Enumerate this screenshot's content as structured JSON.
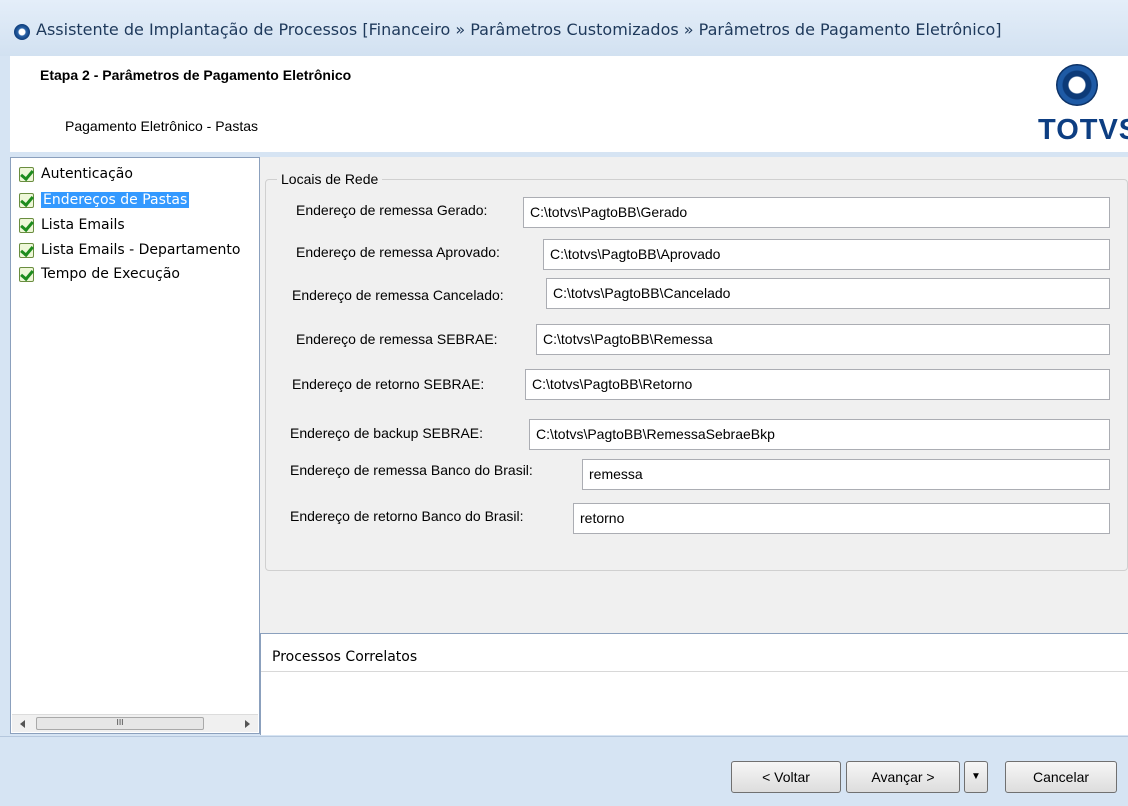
{
  "window": {
    "title": "Assistente de Implantação de Processos [Financeiro » Parâmetros Customizados  » Parâmetros de Pagamento Eletrônico]",
    "app_icon": "app-globe-icon"
  },
  "header": {
    "step_title": "Etapa 2 - Parâmetros de Pagamento Eletrônico",
    "subtitle": "Pagamento Eletrônico - Pastas",
    "logo_text": "TOTVS"
  },
  "tree": {
    "items": [
      {
        "label": "Autenticação",
        "selected": false,
        "icon": "check-icon"
      },
      {
        "label": "Endereços de Pastas",
        "selected": true,
        "icon": "check-icon"
      },
      {
        "label": "Lista Emails",
        "selected": false,
        "icon": "check-icon"
      },
      {
        "label": "Lista Emails - Departamento",
        "selected": false,
        "icon": "check-icon"
      },
      {
        "label": "Tempo de Execução",
        "selected": false,
        "icon": "check-icon"
      }
    ],
    "scroll_thumb_grip": "III"
  },
  "group": {
    "title": "Locais de Rede",
    "fields": [
      {
        "label": "Endereço de remessa Gerado:",
        "value": "C:\\totvs\\PagtoBB\\Gerado"
      },
      {
        "label": "Endereço de remessa Aprovado:",
        "value": "C:\\totvs\\PagtoBB\\Aprovado"
      },
      {
        "label": "Endereço de remessa Cancelado:",
        "value": "C:\\totvs\\PagtoBB\\Cancelado"
      },
      {
        "label": "Endereço de remessa SEBRAE:",
        "value": "C:\\totvs\\PagtoBB\\Remessa"
      },
      {
        "label": "Endereço de retorno SEBRAE:",
        "value": "C:\\totvs\\PagtoBB\\Retorno"
      },
      {
        "label": "Endereço de backup SEBRAE:",
        "value": "C:\\totvs\\PagtoBB\\RemessaSebraeBkp"
      },
      {
        "label": "Endereço de remessa Banco do Brasil:",
        "value": "remessa"
      },
      {
        "label": "Endereço de retorno Banco do Brasil:",
        "value": "retorno"
      }
    ]
  },
  "correlatos": {
    "title": "Processos Correlatos"
  },
  "footer": {
    "back_label": "< Voltar",
    "next_label": "Avançar >",
    "dropdown_icon": "triangle-down-icon",
    "cancel_label": "Cancelar"
  },
  "colors": {
    "selection": "#3399ff",
    "logo_blue": "#0d3e82",
    "window_bg": "#d6e4f3"
  }
}
